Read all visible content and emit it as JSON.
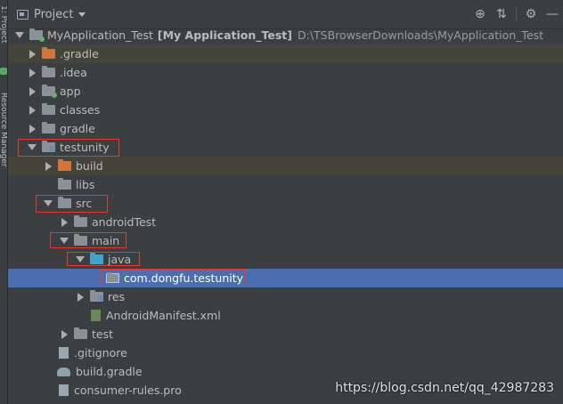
{
  "sidestrip": {
    "label_top": "1: Project",
    "label_resource": "Resource Manager"
  },
  "toolbar": {
    "title": "Project",
    "icons": [
      "target-icon",
      "collapse-icon",
      "gear-icon",
      "minimize-icon"
    ]
  },
  "tree": {
    "root": {
      "name": "MyApplication_Test",
      "module": "[My Application_Test]",
      "path": "D:\\TSBrowserDownloads\\MyApplication_Test"
    },
    "items": [
      {
        "label": "gradle",
        "display": ".gradle"
      },
      {
        "label": ".idea"
      },
      {
        "label": "app"
      },
      {
        "label": "classes"
      },
      {
        "label": "gradle"
      },
      {
        "label": "testunity"
      },
      {
        "label": "build"
      },
      {
        "label": "libs"
      },
      {
        "label": "src"
      },
      {
        "label": "androidTest"
      },
      {
        "label": "main"
      },
      {
        "label": "java"
      },
      {
        "label": "com.dongfu.testunity"
      },
      {
        "label": "res"
      },
      {
        "label": "AndroidManifest.xml"
      },
      {
        "label": "test"
      },
      {
        "label": ".gitignore"
      },
      {
        "label": "build.gradle"
      },
      {
        "label": "consumer-rules.pro"
      }
    ]
  },
  "watermark": "https://blog.csdn.net/qq_42987283"
}
